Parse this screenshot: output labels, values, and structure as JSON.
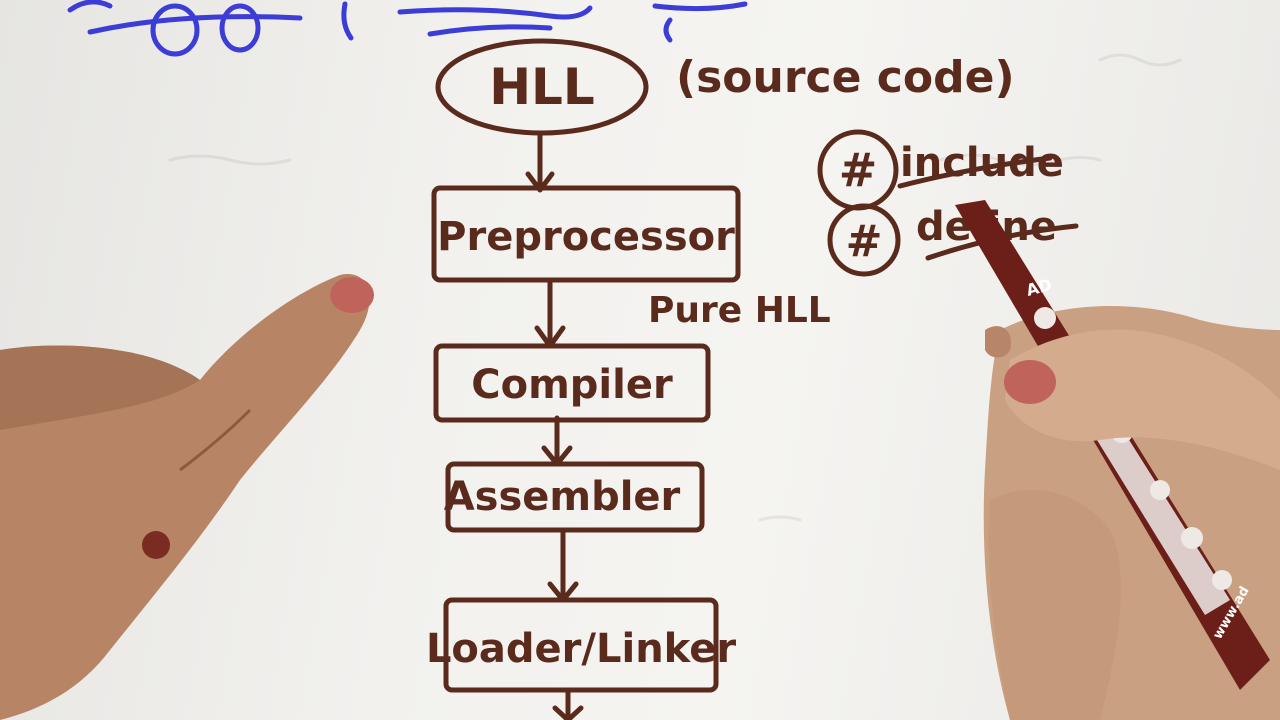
{
  "diagram": {
    "title_node": "HLL",
    "title_note": "(source code)",
    "steps": [
      "Preprocessor",
      "Compiler",
      "Assembler",
      "Loader/Linker"
    ],
    "preprocessor_output": "Pure HLL",
    "directives": [
      {
        "symbol": "#",
        "word": "include"
      },
      {
        "symbol": "#",
        "word": "define"
      }
    ],
    "pen_brand": "AD",
    "pen_url": "www.ad"
  },
  "colors": {
    "ink_brown": "#5a2a1c",
    "ink_blue": "#3c3cd6",
    "paper": "#f3f2ef",
    "skin": "#c99a7c",
    "pen_body": "#6b1f18"
  }
}
